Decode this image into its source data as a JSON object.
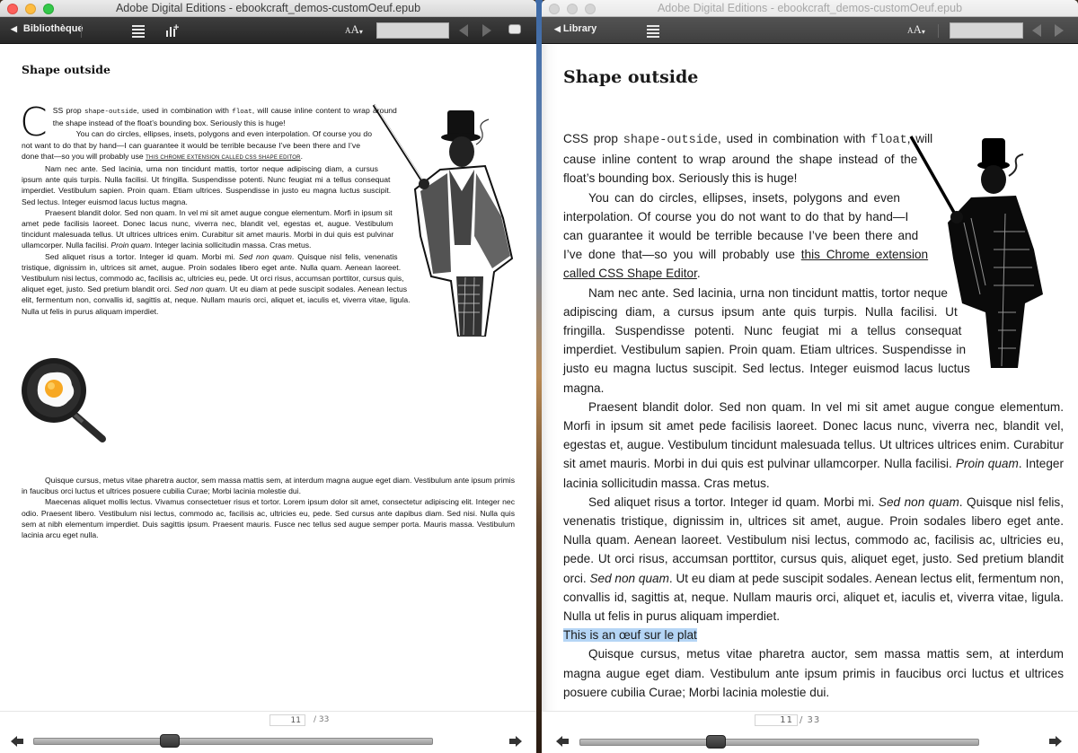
{
  "left_window": {
    "title": "Adobe Digital Editions - ebookcraft_demos-customOeuf.epub",
    "toolbar": {
      "back_label": "Bibliothèque",
      "search_value": "",
      "icons": [
        "back-arrow-icon",
        "table-of-contents-icon",
        "bookmark-stats-icon",
        "font-size-icon",
        "previous-icon",
        "next-icon",
        "fullscreen-icon"
      ]
    },
    "page": {
      "heading": "Shape outside",
      "dropcap": "C",
      "p1_pre": "SS prop ",
      "p1_code1": "shape-outside",
      "p1_mid": ", used in combination with ",
      "p1_code2": "float",
      "p1_post": ", will cause inline content to wrap around the shape instead of the float’s bounding box. Seriously this is huge!",
      "p2_text": "You can do circles, ellipses, insets, polygons and even interpolation. Of course you do not want to do that by hand—I can guarantee it would be terrible because I’ve been there and I’ve done that—so you will probably use ",
      "p2_link": "this Chrome extension called CSS Shape Editor",
      "p2_end": ".",
      "p3": "Nam nec ante. Sed lacinia, urna non tincidunt mattis, tortor neque adipiscing diam, a cursus ipsum ante quis turpis. Nulla facilisi. Ut fringilla. Suspendisse potenti. Nunc feugiat mi a tellus consequat imperdiet. Vestibulum sapien. Proin quam. Etiam ultrices. Suspendisse in justo eu magna luctus suscipit. Sed lectus. Integer euismod lacus luctus magna.",
      "p4_pre": "Praesent blandit dolor. Sed non quam. In vel mi sit amet augue congue elementum. Morfi in ipsum sit amet pede facilisis laoreet. Donec lacus nunc, viverra nec, blandit vel, egestas et, augue. Vestibulum tincidunt malesuada tellus. Ut ultrices ultrices enim. Curabitur sit amet mauris. Morbi in dui quis est pulvinar ullamcorper. Nulla facilisi. ",
      "p4_em": "Proin quam",
      "p4_post": ". Integer lacinia sollicitudin massa. Cras metus.",
      "p5_pre": "Sed aliquet risus a tortor. Integer id quam. Morbi mi. ",
      "p5_em1": "Sed non quam",
      "p5_mid": ". Quisque nisl felis, venenatis tristique, dignissim in, ultrices sit amet, augue. Proin sodales libero eget ante. Nulla quam. Aenean laoreet. Vestibulum nisi lectus, commodo ac, facilisis ac, ultricies eu, pede. Ut orci risus, accumsan porttitor, cursus quis, aliquet eget, justo. Sed pretium blandit orci. ",
      "p5_em2": "Sed non quam",
      "p5_post": ". Ut eu diam at pede suscipit sodales. Aenean lectus elit, fermentum non, convallis id, sagittis at, neque. Nullam mauris orci, aliquet et, iaculis et, viverra vitae, ligula. Nulla ut felis in purus aliquam imperdiet.",
      "p6": "Quisque cursus, metus vitae pharetra auctor, sem massa mattis sem, at interdum magna augue eget diam. Vestibulum ante ipsum primis in faucibus orci luctus et ultrices posuere cubilia Curae; Morbi lacinia molestie dui.",
      "p7": "Maecenas aliquet mollis lectus. Vivamus consectetuer risus et tortor. Lorem ipsum dolor sit amet, consectetur adipiscing elit. Integer nec odio. Praesent libero. Vestibulum nisi lectus, commodo ac, facilisis ac, ultricies eu, pede. Sed cursus ante dapibus diam. Sed nisi. Nulla quis sem at nibh elementum imperdiet. Duis sagittis ipsum. Praesent mauris. Fusce nec tellus sed augue semper porta. Mauris massa. Vestibulum lacinia arcu eget nulla.",
      "images": [
        "gentleman-illustration",
        "fried-egg-pan-image"
      ]
    },
    "footer": {
      "current_page": "11",
      "total_pages": "/ 33",
      "progress_fraction": 0.333
    }
  },
  "right_window": {
    "title": "Adobe Digital Editions - ebookcraft_demos-customOeuf.epub",
    "toolbar": {
      "back_label": "Library",
      "search_value": "",
      "icons": [
        "back-arrow-icon",
        "table-of-contents-icon",
        "font-size-icon",
        "previous-icon",
        "next-icon"
      ]
    },
    "page": {
      "heading": "Shape outside",
      "p1_pre": "CSS prop ",
      "p1_code1": "shape-outside",
      "p1_mid": ", used in combination with ",
      "p1_code2": "float",
      "p1_post": ", will cause inline content to wrap around the shape instead of the float’s bounding box. Seriously this is huge!",
      "p2_text": "You can do circles, ellipses, insets, polygons and even interpolation. Of course you do not want to do that by hand—I can guarantee it would be terrible because I’ve been there and I’ve done that—so you will probably use ",
      "p2_link": "this Chrome extension called CSS Shape Editor",
      "p2_end": ".",
      "p3": "Nam nec ante. Sed lacinia, urna non tincidunt mattis, tortor neque adipiscing diam, a cursus ipsum ante quis turpis. Nulla facilisi. Ut fringilla. Suspendisse potenti. Nunc feugiat mi a tellus consequat imperdiet. Vestibulum sapien. Proin quam. Etiam ultrices. Suspendisse in justo eu magna luctus suscipit. Sed lectus. Integer euismod lacus luctus magna.",
      "p4_pre": "Praesent blandit dolor. Sed non quam. In vel mi sit amet augue congue elementum. Morfi in ipsum sit amet pede facilisis laoreet. Donec lacus nunc, viverra nec, blandit vel, egestas et, augue. Vestibulum tincidunt malesuada tellus. Ut ultrices ultrices enim. Curabitur sit amet mauris. Morbi in dui quis est pulvinar ullamcorper. Nulla facilisi. ",
      "p4_em": "Proin quam",
      "p4_post": ". Integer lacinia sollicitudin massa. Cras metus.",
      "p5_pre": "Sed aliquet risus a tortor. Integer id quam. Morbi mi. ",
      "p5_em1": "Sed non quam",
      "p5_mid": ". Quisque nisl felis, venenatis tristique, dignissim in, ultrices sit amet, augue. Proin sodales libero eget ante. Nulla quam. Aenean laoreet. Vestibulum nisi lectus, commodo ac, facilisis ac, ultricies eu, pede. Ut orci risus, accumsan porttitor, cursus quis, aliquet eget, justo. Sed pretium blandit orci. ",
      "p5_em2": "Sed non quam",
      "p5_post": ". Ut eu diam at pede suscipit sodales. Aenean lectus elit, fermentum non, convallis id, sagittis at, neque. Nullam mauris orci, aliquet et, iaculis et, viverra vitae, ligula. Nulla ut felis in purus aliquam imperdiet.",
      "alt_text_highlight": "This is an œuf sur le plat",
      "p6": "Quisque cursus, metus vitae pharetra auctor, sem massa mattis sem, at interdum magna augue eget diam. Vestibulum ante ipsum primis in faucibus orci luctus et ultrices posuere cubilia Curae; Morbi lacinia molestie dui.",
      "images": [
        "gentleman-illustration"
      ]
    },
    "footer": {
      "current_page": "11",
      "total_pages": "/ 33",
      "progress_fraction": 0.333
    }
  },
  "colors": {
    "highlight": "#b5d5f5",
    "toolbar_dark": "#2e2e2e",
    "desktop_accent": "#3d6aa8"
  }
}
